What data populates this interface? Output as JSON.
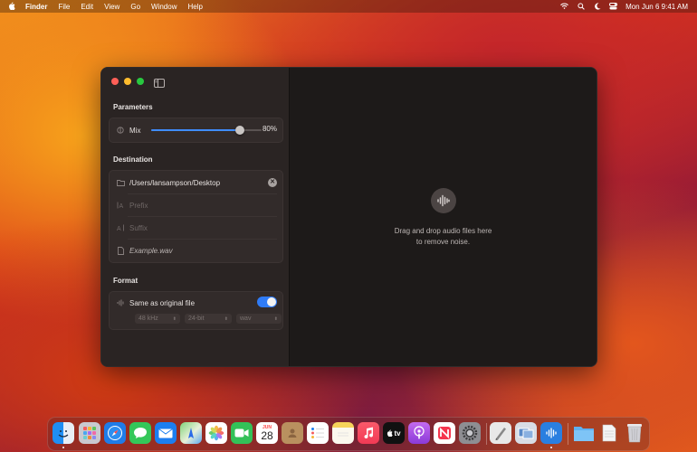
{
  "menubar": {
    "apple": "",
    "items": [
      "Finder",
      "File",
      "Edit",
      "View",
      "Go",
      "Window",
      "Help"
    ],
    "clock": "Mon Jun 6  9:41 AM",
    "status_icons": [
      "wifi-icon",
      "search-icon",
      "moon-icon",
      "control-center-icon"
    ]
  },
  "window": {
    "parameters": {
      "title": "Parameters",
      "mix_label": "Mix",
      "mix_value_text": "80%",
      "mix_fraction": 0.8
    },
    "destination": {
      "title": "Destination",
      "path": "/Users/lansampson/Desktop",
      "prefix_placeholder": "Prefix",
      "suffix_placeholder": "Suffix",
      "example_filename": "Example.wav"
    },
    "format": {
      "title": "Format",
      "same_as_original_label": "Same as original file",
      "same_as_original_enabled": true,
      "sample_rate": "48 kHz",
      "bit_depth": "24-bit",
      "file_type": "wav"
    },
    "dropzone": {
      "line1": "Drag and drop audio files here",
      "line2": "to remove noise."
    }
  },
  "dock": {
    "calendar_day": "28",
    "calendar_month": "JUN",
    "tv_label": "tv",
    "apps": [
      "finder-icon",
      "launchpad-icon",
      "safari-icon",
      "messages-icon",
      "mail-icon",
      "maps-icon",
      "photos-icon",
      "facetime-icon",
      "calendar-icon",
      "contacts-icon",
      "reminders-icon",
      "notes-icon",
      "music-icon",
      "tv-icon",
      "podcasts-icon",
      "news-icon",
      "system-settings-icon",
      "script-editor-icon",
      "preview-icon",
      "audio-app-icon",
      "downloads-folder-icon",
      "document-icon",
      "trash-icon"
    ]
  },
  "colors": {
    "accent": "#2f7bf6",
    "close": "#fe5f57",
    "minimize": "#febc2e",
    "zoom": "#28c840"
  }
}
